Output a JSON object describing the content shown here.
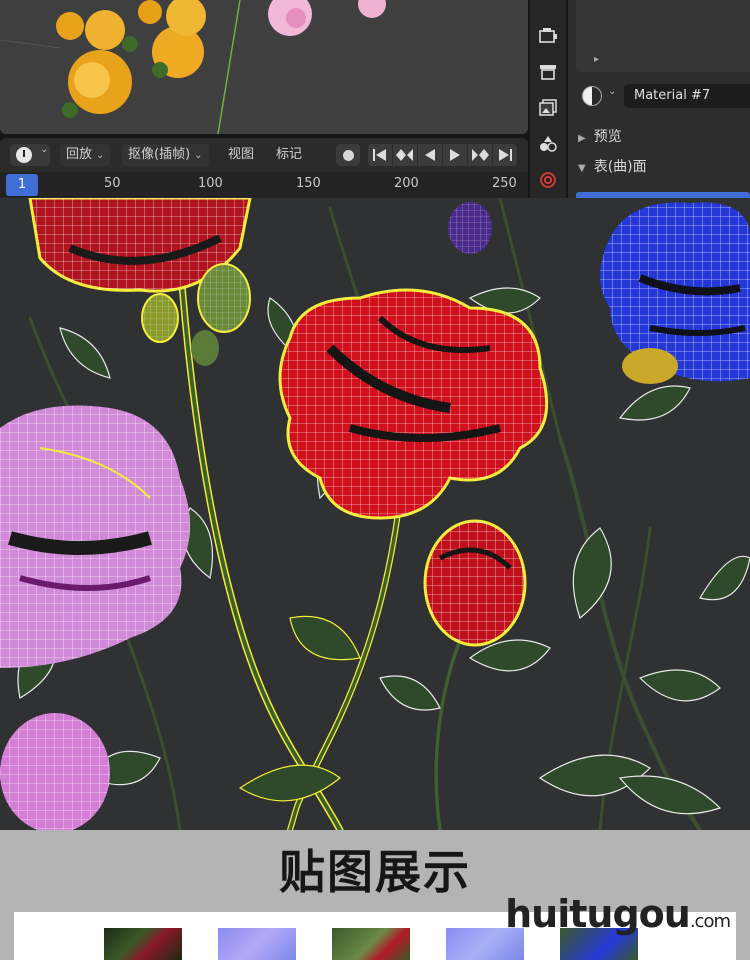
{
  "timeline": {
    "editor_icon": "clock-icon",
    "playback_label": "回放",
    "keying_label": "抠像(插帧)",
    "view_label": "视图",
    "marker_label": "标记",
    "current_frame": "1",
    "ruler_ticks": [
      "50",
      "100",
      "150",
      "200",
      "250"
    ]
  },
  "properties": {
    "material_name": "Material #7",
    "sections": [
      "预览",
      "表(曲)面"
    ],
    "side_icons": [
      "render-icon",
      "output-icon",
      "view-layer-icon",
      "physics-icon",
      "world-icon"
    ]
  },
  "texture_section": {
    "title": "贴图展示",
    "thumbnails": [
      "diffuse-texture",
      "normal-map",
      "leaf-texture",
      "normal-map",
      "flower-texture"
    ]
  },
  "watermark": {
    "brand": "huitugou",
    "suffix": ".com"
  },
  "colors": {
    "accent_blue": "#3f6fd6",
    "wire_highlight": "#f4ec3a",
    "background": "#303133"
  }
}
